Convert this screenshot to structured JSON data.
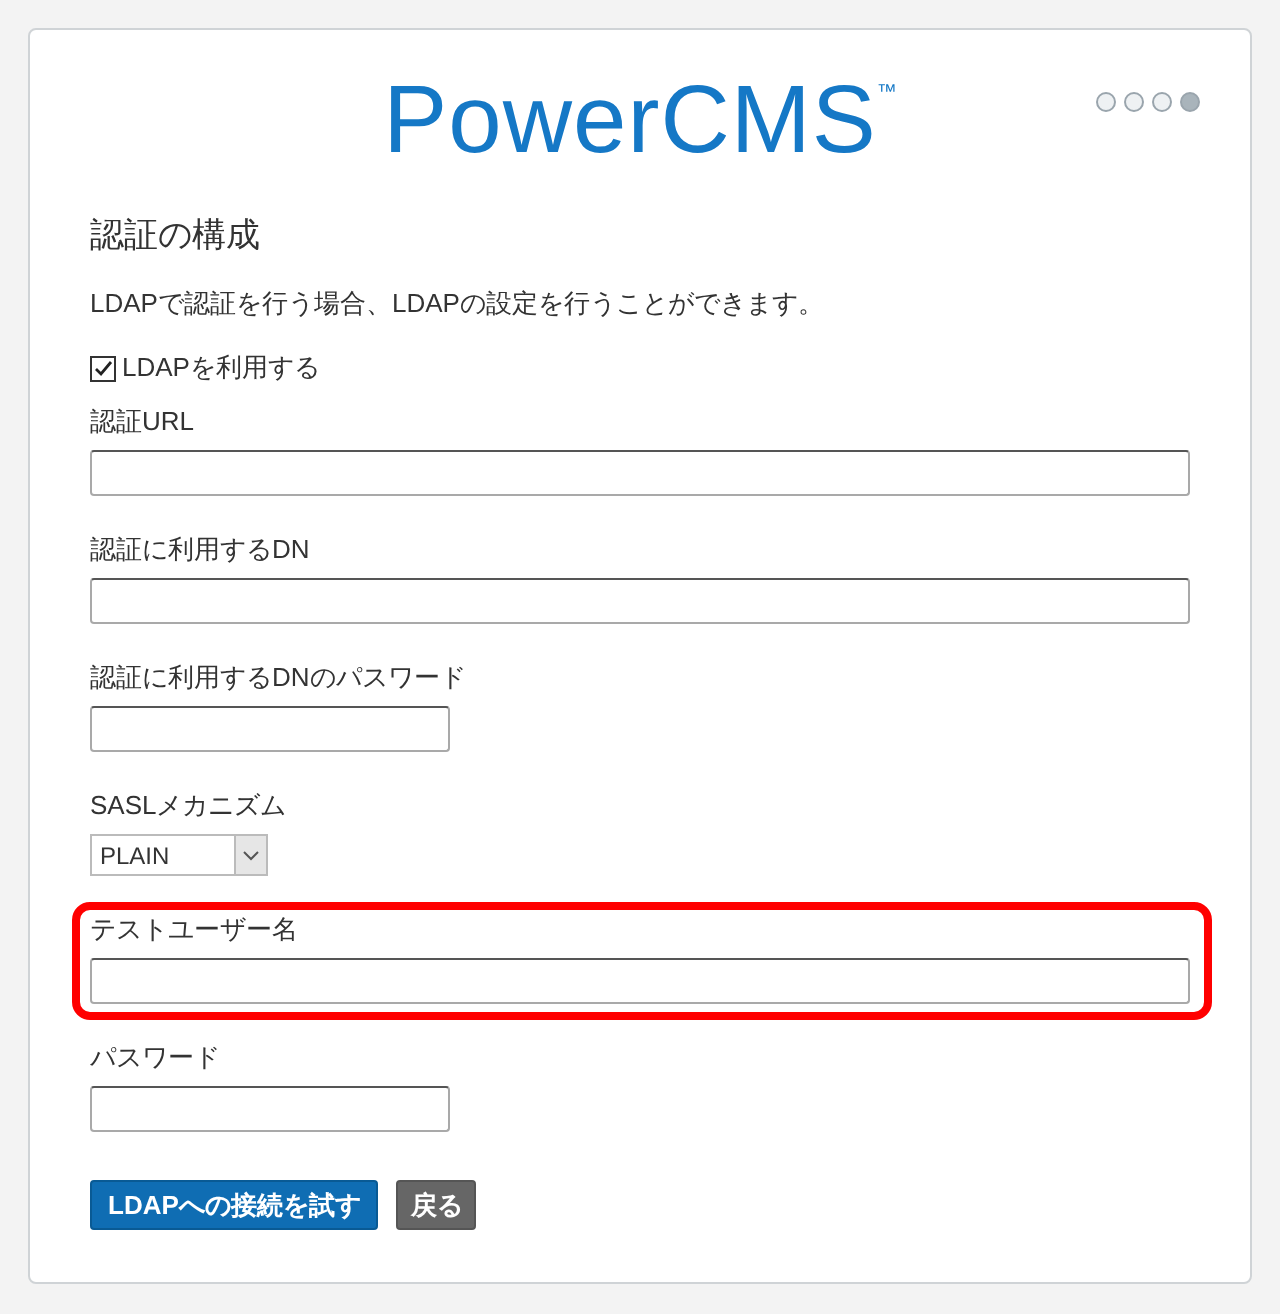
{
  "logo": {
    "text": "PowerCMS",
    "mark": "™"
  },
  "steps": [
    {
      "selected": false
    },
    {
      "selected": false
    },
    {
      "selected": false
    },
    {
      "selected": true
    }
  ],
  "heading": "認証の構成",
  "description": "LDAPで認証を行う場合、LDAPの設定を行うことができます。",
  "checkbox": {
    "label": "LDAPを利用する",
    "checked": true
  },
  "fields": [
    {
      "kind": "wide",
      "label": "認証URL",
      "highlighted": false
    },
    {
      "kind": "wide",
      "label": "認証に利用するDN",
      "highlighted": false
    },
    {
      "kind": "narrow",
      "label": "認証に利用するDNのパスワード",
      "highlighted": false
    },
    {
      "kind": "select",
      "label": "SASLメカニズム",
      "value": "PLAIN",
      "highlighted": false
    },
    {
      "kind": "wide",
      "label": "テストユーザー名",
      "highlighted": true
    },
    {
      "kind": "narrow",
      "label": "パスワード",
      "highlighted": false
    }
  ],
  "buttons": [
    {
      "label": "LDAPへの接続を試す",
      "kind": "primary"
    },
    {
      "label": "戻る",
      "kind": "secondary"
    }
  ]
}
